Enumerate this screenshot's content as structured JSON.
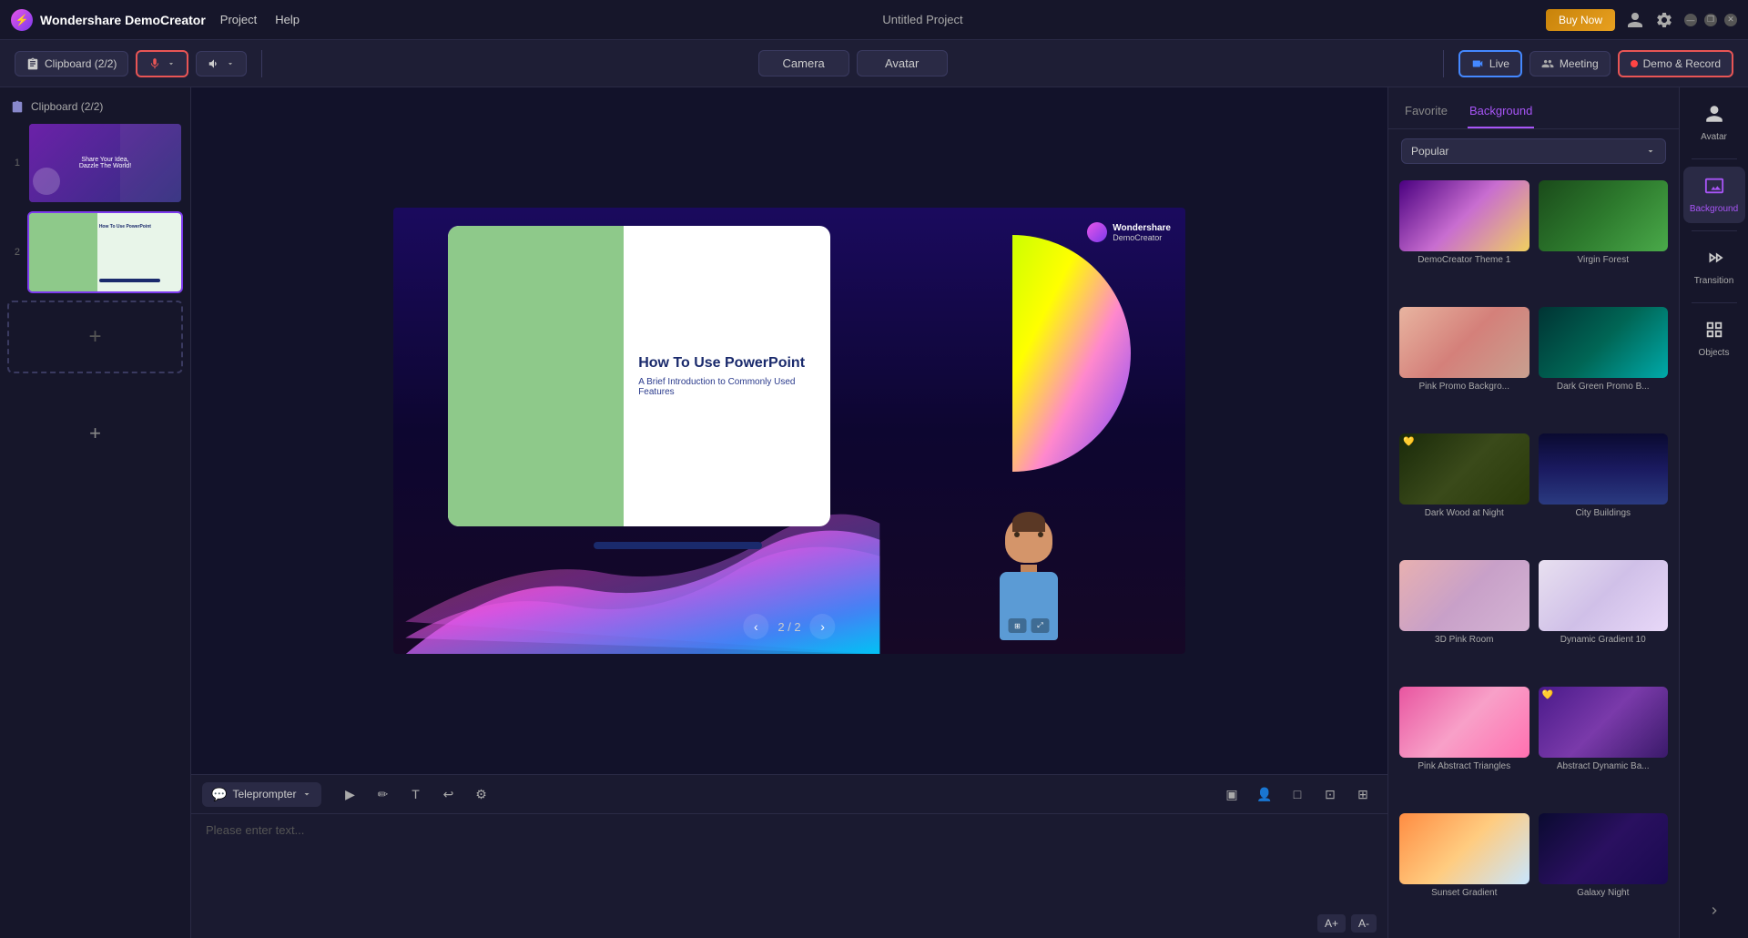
{
  "app": {
    "name": "Wondershare DemoCreator",
    "project_title": "Untitled Project"
  },
  "title_bar": {
    "app_name": "Wondershare DemoCreator",
    "menu_items": [
      "Project",
      "Help"
    ],
    "buy_now": "Buy Now",
    "window_controls": [
      "—",
      "❐",
      "✕"
    ]
  },
  "toolbar": {
    "clipboard_label": "Clipboard (2/2)",
    "mic_label": "Microphone",
    "audio_label": "Audio",
    "camera_label": "Camera",
    "avatar_label": "Avatar",
    "live_label": "Live",
    "meeting_label": "Meeting",
    "demo_record_label": "Demo & Record"
  },
  "slides": {
    "panel_title": "Clipboard (2/2)",
    "items": [
      {
        "number": "1",
        "thumb_type": "thumb1"
      },
      {
        "number": "2",
        "thumb_type": "thumb2"
      }
    ],
    "add_slide_label": "+"
  },
  "canvas": {
    "slide_title": "How To Use PowerPoint",
    "slide_subtitle": "A Brief Introduction to Commonly Used Features",
    "watermark_brand": "Wondershare",
    "watermark_sub": "DemoCreator",
    "nav_current": "2 / 2"
  },
  "teleprompter": {
    "label": "Teleprompter",
    "placeholder": "Please enter text...",
    "font_size_increase": "A+",
    "font_size_decrease": "A-"
  },
  "background_panel": {
    "tabs": [
      "Favorite",
      "Background"
    ],
    "active_tab": "Background",
    "filter_label": "Popular",
    "items": [
      {
        "id": "democreator-theme",
        "label": "DemoCreator Theme 1",
        "class": "bg-democreator",
        "favorite": false
      },
      {
        "id": "virgin-forest",
        "label": "Virgin Forest",
        "class": "bg-virgin-forest",
        "favorite": false
      },
      {
        "id": "pink-promo",
        "label": "Pink Promo Backgro...",
        "class": "bg-pink-promo",
        "favorite": false
      },
      {
        "id": "dark-green-promo",
        "label": "Dark Green Promo B...",
        "class": "bg-dark-green",
        "favorite": false
      },
      {
        "id": "dark-wood",
        "label": "Dark Wood at Night",
        "class": "bg-dark-wood",
        "favorite": true
      },
      {
        "id": "city-buildings",
        "label": "City Buildings",
        "class": "bg-city-buildings",
        "favorite": false
      },
      {
        "id": "3d-pink-room",
        "label": "3D Pink Room",
        "class": "bg-3d-pink",
        "favorite": false
      },
      {
        "id": "dynamic-gradient-10",
        "label": "Dynamic Gradient 10",
        "class": "bg-dyn-grad",
        "favorite": false
      },
      {
        "id": "pink-abstract",
        "label": "Pink Abstract Triangles",
        "class": "bg-pink-abstract",
        "favorite": false
      },
      {
        "id": "abstract-dynamic",
        "label": "Abstract Dynamic Ba...",
        "class": "bg-abstract-dyn",
        "favorite": true
      },
      {
        "id": "gradient1",
        "label": "Sunset Gradient",
        "class": "bg-gradient1",
        "favorite": false
      },
      {
        "id": "galaxy",
        "label": "Galaxy Night",
        "class": "bg-galaxy",
        "favorite": false
      }
    ]
  },
  "icon_panel": {
    "items": [
      {
        "id": "avatar",
        "label": "Avatar",
        "icon": "👤"
      },
      {
        "id": "background",
        "label": "Background",
        "icon": "🖼",
        "active": true
      },
      {
        "id": "transition",
        "label": "Transition",
        "icon": "⏭"
      },
      {
        "id": "objects",
        "label": "Objects",
        "icon": "⊞"
      }
    ]
  }
}
